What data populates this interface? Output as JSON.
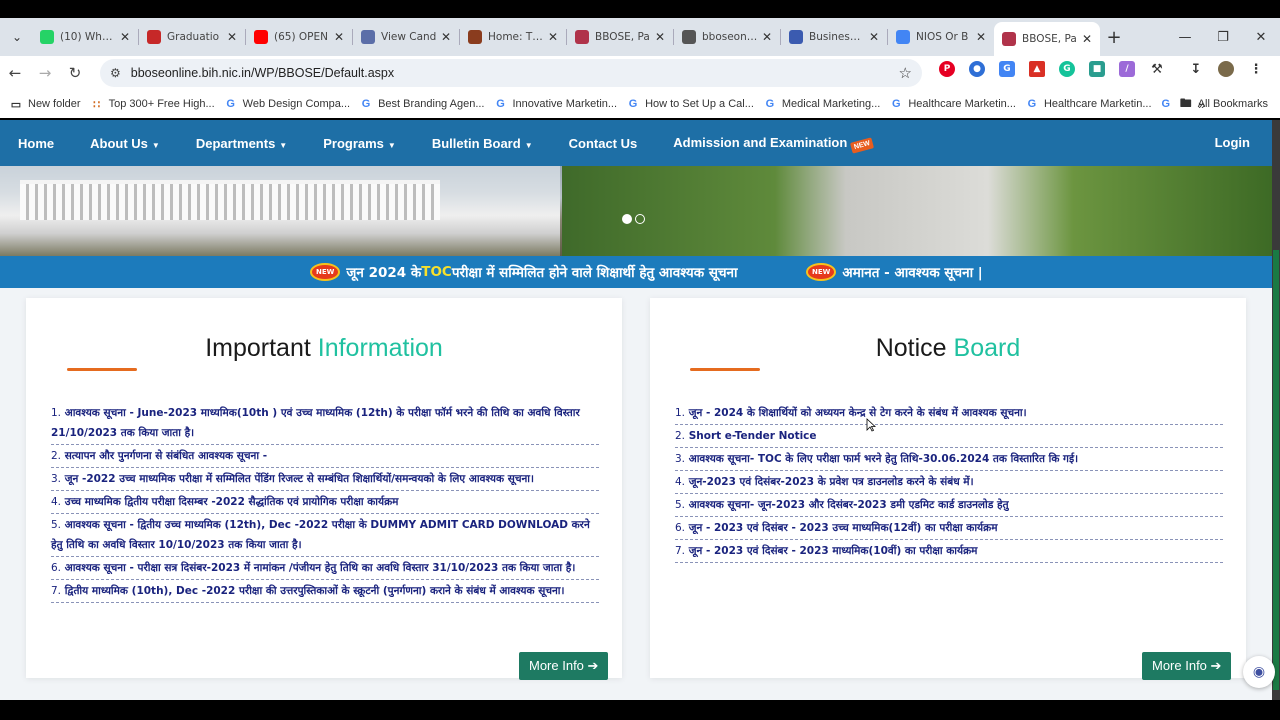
{
  "browser": {
    "tabs": [
      {
        "title": "(10) Whats",
        "icon": "whatsapp-icon",
        "color": "#25d366"
      },
      {
        "title": "Graduatio",
        "icon": "document-icon",
        "color": "#c62828"
      },
      {
        "title": "(65) OPEN",
        "icon": "youtube-icon",
        "color": "#ff0000"
      },
      {
        "title": "View Cand",
        "icon": "w-icon",
        "color": "#5b6ea8"
      },
      {
        "title": "Home: The",
        "icon": "emblem-icon",
        "color": "#8a3c1e"
      },
      {
        "title": "BBOSE, Pa",
        "icon": "bbose-icon",
        "color": "#b0334a"
      },
      {
        "title": "bboseonlin",
        "icon": "globe-icon",
        "color": "#555555"
      },
      {
        "title": "Businesses",
        "icon": "business-icon",
        "color": "#3b5bb0"
      },
      {
        "title": "NIOS Or B",
        "icon": "google-icon",
        "color": "#4285f4"
      },
      {
        "title": "BBOSE, Pa",
        "icon": "bbose-icon",
        "color": "#b0334a",
        "active": true
      }
    ],
    "url": "bboseonline.bih.nic.in/WP/BBOSE/Default.aspx",
    "bookmarks": [
      {
        "label": "New folder",
        "icon": "folder-icon"
      },
      {
        "label": "Top 300+ Free High...",
        "icon": "dots-icon"
      },
      {
        "label": "Web Design Compa...",
        "icon": "google-icon"
      },
      {
        "label": "Best Branding Agen...",
        "icon": "google-icon"
      },
      {
        "label": "Innovative Marketin...",
        "icon": "google-icon"
      },
      {
        "label": "How to Set Up a Cal...",
        "icon": "google-icon"
      },
      {
        "label": "Medical Marketing...",
        "icon": "google-icon"
      },
      {
        "label": "Healthcare Marketin...",
        "icon": "google-icon"
      },
      {
        "label": "Healthcare Marketin...",
        "icon": "google-icon"
      }
    ],
    "all_bookmarks": "All Bookmarks"
  },
  "site": {
    "nav": [
      {
        "label": "Home",
        "dropdown": false
      },
      {
        "label": "About Us",
        "dropdown": true
      },
      {
        "label": "Departments",
        "dropdown": true
      },
      {
        "label": "Programs",
        "dropdown": true
      },
      {
        "label": "Bulletin Board",
        "dropdown": true
      },
      {
        "label": "Contact Us",
        "dropdown": false
      },
      {
        "label": "Admission and Examination",
        "dropdown": false,
        "badge": "NEW"
      }
    ],
    "login": "Login",
    "ticker": [
      {
        "pre": "जून 2024 के ",
        "highlight": "TOC",
        "post": " परीक्षा में सम्मिलित होने वाले शिक्षार्थी हेतु आवश्यक सूचना",
        "badge": "NEW"
      },
      {
        "pre": "अमानत - आवश्यक सूचना |",
        "highlight": "",
        "post": "",
        "badge": "NEW"
      }
    ],
    "important": {
      "title_main": "Important",
      "title_accent": "Information",
      "items": [
        {
          "num": "1.",
          "text": "आवश्यक सूचना - June-2023 माध्यमिक(10th ) एवं उच्च माध्यमिक (12th) के परीक्षा फॉर्म भरने की तिथि का अवधि विस्तार 21/10/2023 तक किया जाता है।"
        },
        {
          "num": "2.",
          "text": "सत्यापन और पुनर्गणना से संबंधित आवश्यक सूचना -"
        },
        {
          "num": "3.",
          "text": "जून -2022 उच्च माध्यमिक परीक्षा में सम्मिलित पेंडिंग रिजल्ट से सम्बंधित शिक्षार्थियों/समन्वयको के लिए आवश्यक सूचना।"
        },
        {
          "num": "4.",
          "text": "उच्च माध्यमिक द्वितीय परीक्षा दिसम्बर -2022 सैद्धांतिक एवं प्रायोगिक परीक्षा कार्यक्रम"
        },
        {
          "num": "5.",
          "text": "आवश्यक सूचना - द्वितीय उच्च माध्यमिक (12th), Dec -2022 परीक्षा के DUMMY ADMIT CARD DOWNLOAD करने हेतु तिथि का अवधि विस्तार 10/10/2023 तक किया जाता है।"
        },
        {
          "num": "6.",
          "text": "आवश्यक सूचना - परीक्षा सत्र दिसंबर-2023 में नामांकन /पंजीयन हेतु तिथि का अवधि विस्तार 31/10/2023 तक किया जाता है।"
        },
        {
          "num": "7.",
          "text": "द्वितीय माध्यमिक (10th), Dec -2022 परीक्षा की उत्तरपुस्तिकाओं के स्क्रूटनी (पुनर्गणना) कराने के संबंध में आवश्यक सूचना।"
        }
      ],
      "more": "More Info ➔"
    },
    "notice": {
      "title_main": "Notice",
      "title_accent": "Board",
      "items": [
        {
          "num": "1.",
          "text": "जून - 2024 के शिक्षार्थियों को अध्ययन केन्द्र से टेग करने के संबंध में आवश्यक सूचना।"
        },
        {
          "num": "2.",
          "text": "Short e-Tender Notice"
        },
        {
          "num": "3.",
          "text": "आवश्यक सूचना- TOC के लिए परीक्षा फार्म भरने हेतु तिथि-30.06.2024 तक विस्तारित कि गई।"
        },
        {
          "num": "4.",
          "text": "जून-2023 एवं दिसंबर-2023 के प्रवेश पत्र डाउनलोड करने के संबंध में।"
        },
        {
          "num": "5.",
          "text": "आवश्यक सूचना- जून-2023 और दिसंबर-2023 डमी एडमिट कार्ड डाउनलोड हेतु"
        },
        {
          "num": "6.",
          "text": "जून - 2023 एवं दिसंबर - 2023 उच्च माध्यमिक(12वीं) का परीक्षा कार्यक्रम"
        },
        {
          "num": "7.",
          "text": "जून - 2023 एवं दिसंबर - 2023 माध्यमिक(10वीं) का परीक्षा कार्यक्रम"
        }
      ],
      "more": "More Info ➔"
    }
  },
  "colors": {
    "nav": "#1e6fa6",
    "accent": "#20c1a0",
    "button": "#1e7a62",
    "link": "#1a237e"
  }
}
